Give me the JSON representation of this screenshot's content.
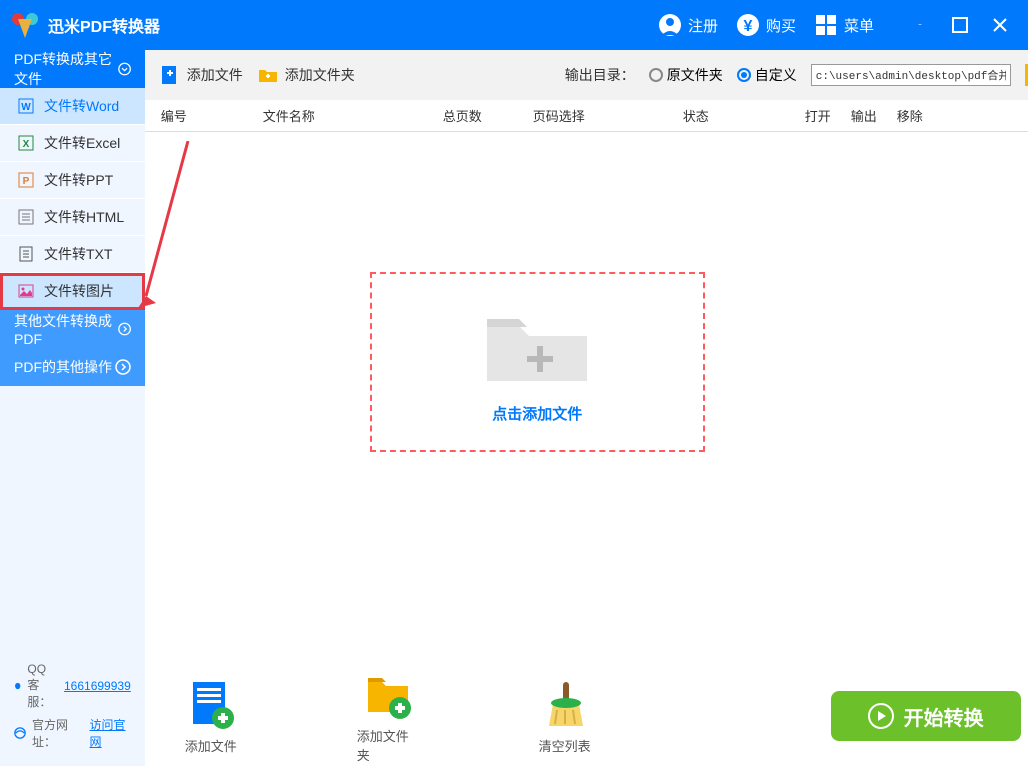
{
  "titlebar": {
    "app_title": "迅米PDF转换器",
    "register": "注册",
    "buy": "购买",
    "menu": "菜单"
  },
  "sidebar": {
    "cat1": "PDF转换成其它文件",
    "cat2": "其他文件转换成PDF",
    "cat3": "PDF的其他操作",
    "items": [
      {
        "label": "文件转Word"
      },
      {
        "label": "文件转Excel"
      },
      {
        "label": "文件转PPT"
      },
      {
        "label": "文件转HTML"
      },
      {
        "label": "文件转TXT"
      },
      {
        "label": "文件转图片"
      }
    ],
    "footer": {
      "qq_label": "QQ 客服：",
      "qq_number": "1661699939",
      "site_label": "官方网址：",
      "site_link": "访问官网"
    }
  },
  "toolbar": {
    "add_file": "添加文件",
    "add_folder": "添加文件夹",
    "output_label": "输出目录：",
    "radio_source": "原文件夹",
    "radio_custom": "自定义",
    "path_value": "c:\\users\\admin\\desktop\\pdf合并"
  },
  "table": {
    "col_num": "编号",
    "col_name": "文件名称",
    "col_pages": "总页数",
    "col_pagesel": "页码选择",
    "col_status": "状态",
    "col_open": "打开",
    "col_out": "输出",
    "col_del": "移除"
  },
  "drop": {
    "text": "点击添加文件"
  },
  "bottombar": {
    "add_file": "添加文件",
    "add_folder": "添加文件夹",
    "clear_list": "清空列表",
    "start": "开始转换"
  }
}
